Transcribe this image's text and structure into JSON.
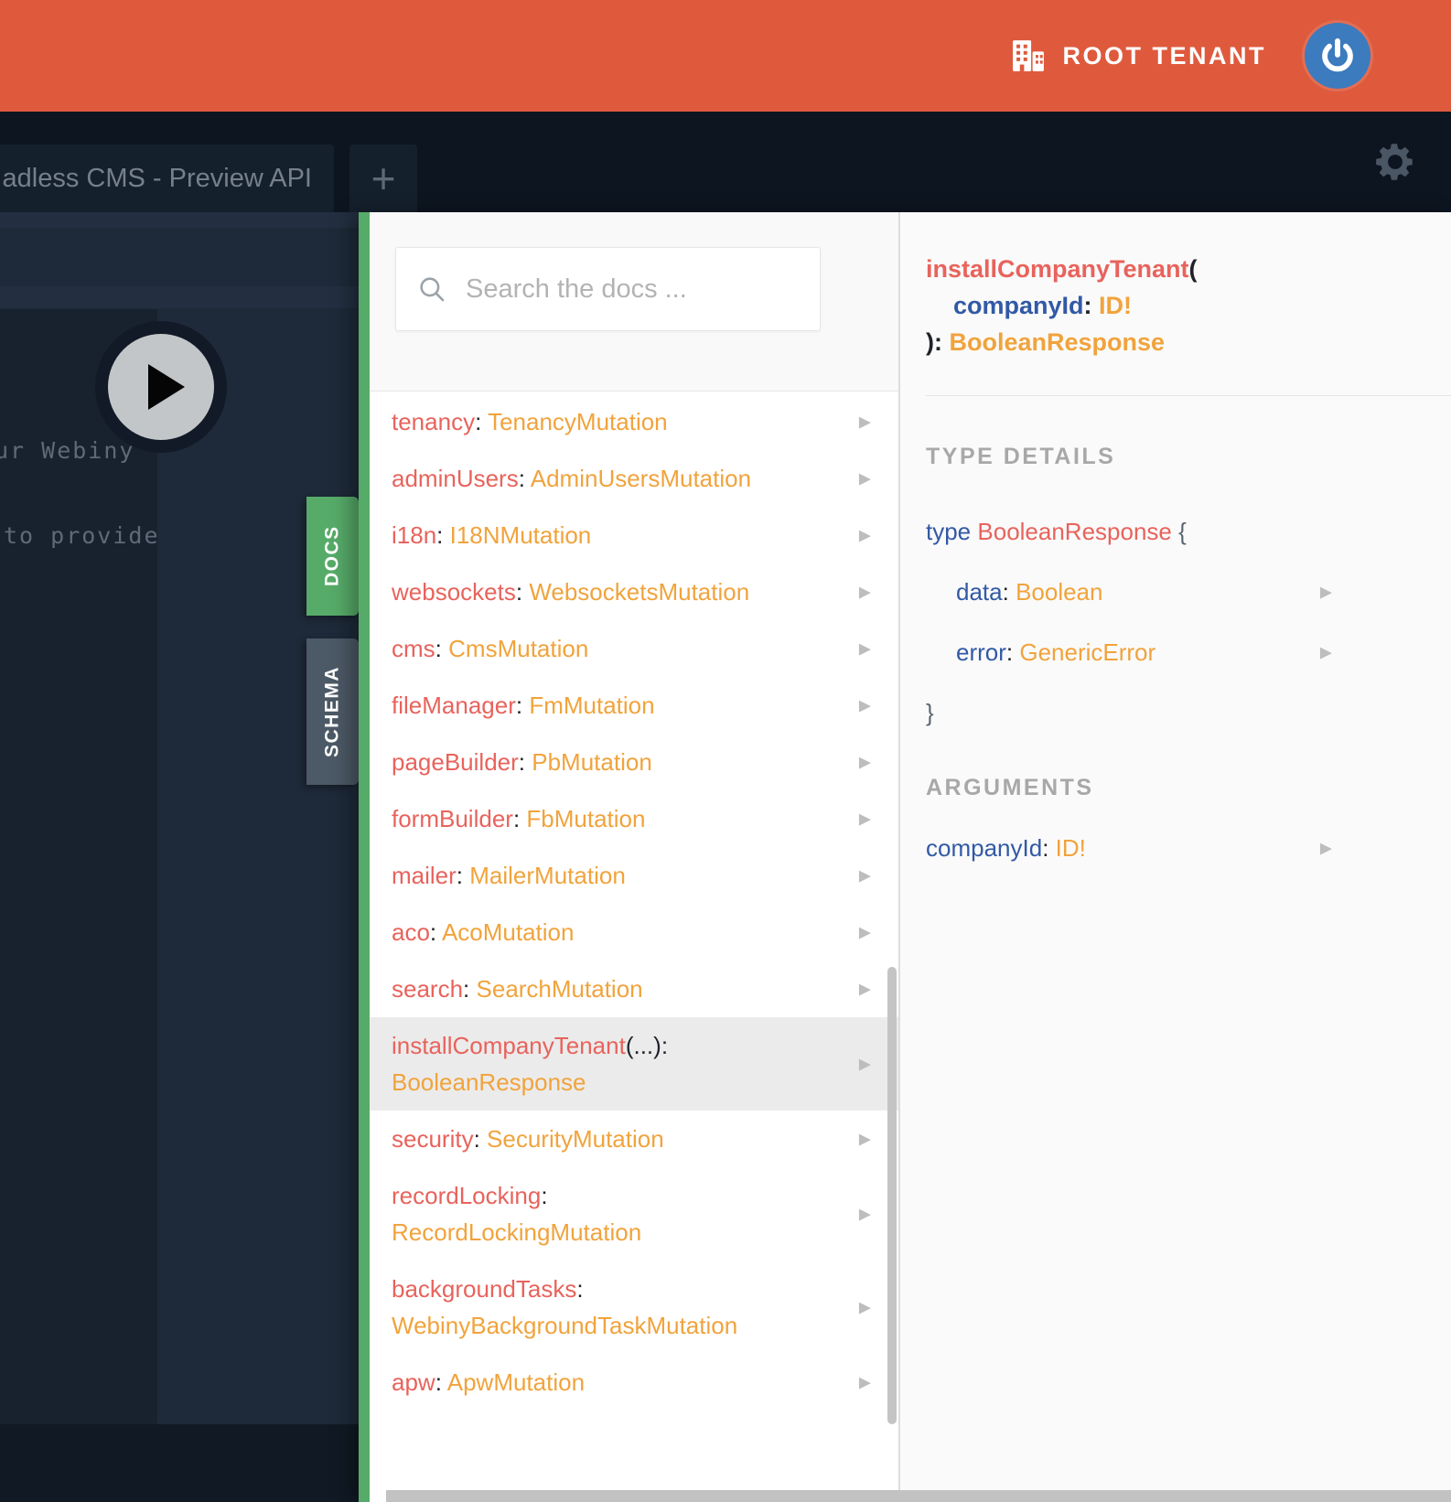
{
  "topbar": {
    "tenant_label": "ROOT TENANT"
  },
  "tabbar": {
    "tab_label": "adless CMS - Preview API",
    "new_tab_label": "+"
  },
  "editor": {
    "comment_line_1": "ur Webiny",
    "comment_line_2": "to provide"
  },
  "side_tabs": {
    "docs": "DOCS",
    "schema": "SCHEMA"
  },
  "docs_panel": {
    "search_placeholder": "Search the docs ...",
    "fields": [
      {
        "name": "tenancy",
        "type": "TenancyMutation"
      },
      {
        "name": "adminUsers",
        "type": "AdminUsersMutation"
      },
      {
        "name": "i18n",
        "type": "I18NMutation"
      },
      {
        "name": "websockets",
        "type": "WebsocketsMutation"
      },
      {
        "name": "cms",
        "type": "CmsMutation"
      },
      {
        "name": "fileManager",
        "type": "FmMutation"
      },
      {
        "name": "pageBuilder",
        "type": "PbMutation"
      },
      {
        "name": "formBuilder",
        "type": "FbMutation"
      },
      {
        "name": "mailer",
        "type": "MailerMutation"
      },
      {
        "name": "aco",
        "type": "AcoMutation"
      },
      {
        "name": "search",
        "type": "SearchMutation"
      },
      {
        "name": "installCompanyTenant",
        "args": "(...)",
        "type": "BooleanResponse",
        "highlighted": true,
        "two_line": true
      },
      {
        "name": "security",
        "type": "SecurityMutation"
      },
      {
        "name": "recordLocking",
        "type": "RecordLockingMutation",
        "two_line": true
      },
      {
        "name": "backgroundTasks",
        "type": "WebinyBackgroundTaskMutation",
        "two_line": true
      },
      {
        "name": "apw",
        "type": "ApwMutation"
      }
    ]
  },
  "detail_panel": {
    "header": {
      "field_name": "installCompanyTenant",
      "open_paren": "(",
      "arg_name": "companyId",
      "colon": ":",
      "arg_type": "ID!",
      "close_paren": "): ",
      "return_type": "BooleanResponse"
    },
    "type_details": {
      "heading": "TYPE DETAILS",
      "keyword": "type",
      "type_name": "BooleanResponse",
      "open_brace": "{",
      "fields": [
        {
          "name": "data",
          "type": "Boolean"
        },
        {
          "name": "error",
          "type": "GenericError"
        }
      ],
      "close_brace": "}"
    },
    "arguments": {
      "heading": "ARGUMENTS",
      "items": [
        {
          "name": "companyId",
          "type": "ID!"
        }
      ]
    }
  },
  "syntax": {
    "colon": ":"
  },
  "icons": {
    "tenant": "building-icon",
    "logout": "power-icon",
    "settings": "gear-icon",
    "search": "magnifier-icon",
    "execute": "play-icon",
    "expand": "▶"
  },
  "colors": {
    "topbar_orange": "#DF5A3D",
    "logo_blue": "#3B7BBE",
    "panel_green": "#57AB69",
    "schema_slate": "#4C5966",
    "field_red": "#E8635C",
    "type_orange": "#F1A33C",
    "keyword_blue": "#3259A5",
    "highlight_gray": "#EBEBEB"
  }
}
